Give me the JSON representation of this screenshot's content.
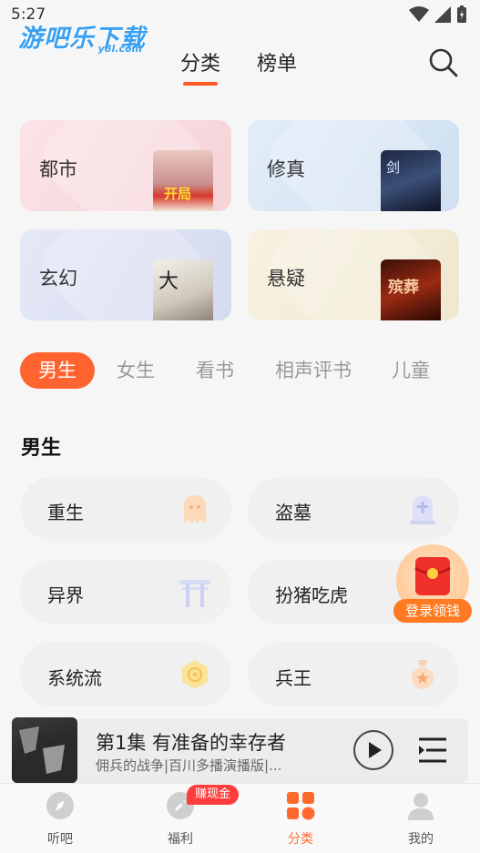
{
  "status_bar": {
    "time": "5:27"
  },
  "logo": {
    "main": "游吧乐下载",
    "sub": "y8l.com"
  },
  "top_tabs": [
    {
      "label": "分类",
      "active": true
    },
    {
      "label": "榜单",
      "active": false
    }
  ],
  "category_cards": [
    {
      "label": "都市",
      "color": "#f9dfe3",
      "cover_text": "开局"
    },
    {
      "label": "修真",
      "color": "#dce9f6",
      "cover_text": "剑"
    },
    {
      "label": "玄幻",
      "color": "#dfe3f3",
      "cover_text": "大"
    },
    {
      "label": "悬疑",
      "color": "#f4efdd",
      "cover_text": "殡葬"
    }
  ],
  "filter_chips": [
    {
      "label": "男生",
      "active": true
    },
    {
      "label": "女生",
      "active": false
    },
    {
      "label": "看书",
      "active": false
    },
    {
      "label": "相声评书",
      "active": false
    },
    {
      "label": "儿童",
      "active": false
    }
  ],
  "section": {
    "title": "男生"
  },
  "genres": [
    {
      "label": "重生",
      "icon": "ghost-icon"
    },
    {
      "label": "盗墓",
      "icon": "tombstone-icon"
    },
    {
      "label": "异界",
      "icon": "torii-gate-icon"
    },
    {
      "label": "扮猪吃虎",
      "icon": ""
    },
    {
      "label": "系统流",
      "icon": "hexagon-badge-icon"
    },
    {
      "label": "兵王",
      "icon": "medal-icon"
    }
  ],
  "floating_reward": {
    "label": "登录领钱"
  },
  "player": {
    "title": "第1集 有准备的幸存者",
    "subtitle": "佣兵的战争|百川多播演播版|..."
  },
  "bottom_nav": [
    {
      "label": "听吧",
      "icon": "compass-icon",
      "active": false
    },
    {
      "label": "福利",
      "icon": "gift-icon",
      "active": false,
      "badge": "赚现金"
    },
    {
      "label": "分类",
      "icon": "grid-icon",
      "active": true
    },
    {
      "label": "我的",
      "icon": "person-icon",
      "active": false
    }
  ],
  "colors": {
    "accent": "#ff6430",
    "logo_blue": "#3aa0f0"
  }
}
